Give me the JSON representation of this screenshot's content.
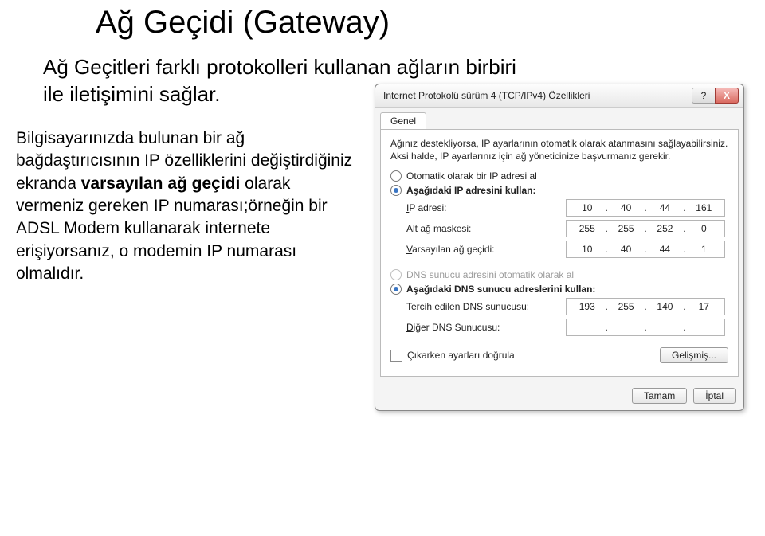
{
  "title": "Ağ Geçidi (Gateway)",
  "subtitle": "Ağ Geçitleri farklı protokolleri kullanan ağların birbiri ile iletişimini sağlar.",
  "paragraph_a": "Bilgisayarınızda bulunan bir ağ bağdaştırıcısının IP özelliklerini değiştirdiğiniz ekranda ",
  "paragraph_bold": "varsayılan ağ geçidi",
  "paragraph_b": " olarak vermeniz gereken IP numarası;örneğin bir ADSL Modem kullanarak internete erişiyorsanız, o modemin IP numarası olmalıdır.",
  "dialog": {
    "title": "Internet Protokolü sürüm 4 (TCP/IPv4) Özellikleri",
    "help_glyph": "?",
    "close_glyph": "X",
    "tab": "Genel",
    "desc": "Ağınız destekliyorsa, IP ayarlarının otomatik olarak atanmasını sağlayabilirsiniz. Aksi halde, IP ayarlarınız için ağ yöneticinize başvurmanız gerekir.",
    "radio1": "Otomatik olarak bir IP adresi al",
    "radio2_prefix_ul": "A",
    "radio2_rest": "şağıdaki IP adresini kullan:",
    "ip_label_prefix": "I",
    "ip_label_rest": "P adresi:",
    "ip_value": [
      "10",
      "40",
      "44",
      "161"
    ],
    "mask_label_prefix": "A",
    "mask_label_rest": "lt ağ maskesi:",
    "mask_value": [
      "255",
      "255",
      "252",
      "0"
    ],
    "gw_label_prefix": "V",
    "gw_label_rest": "arsayılan ağ geçidi:",
    "gw_value": [
      "10",
      "40",
      "44",
      "1"
    ],
    "radio3": "DNS sunucu adresini otomatik olarak al",
    "radio4_prefix_ul": "A",
    "radio4_rest": "şağıdaki DNS sunucu adreslerini kullan:",
    "dns1_label_prefix": "T",
    "dns1_label_rest": "ercih edilen DNS sunucusu:",
    "dns1_value": [
      "193",
      "255",
      "140",
      "17"
    ],
    "dns2_label_prefix": "D",
    "dns2_label_rest": "iğer DNS Sunucusu:",
    "dns2_value": [
      "",
      "",
      "",
      ""
    ],
    "check_exit": "Çıkarken ayarları doğrula",
    "advanced_ul": "G",
    "advanced_rest": "elişmiş...",
    "ok": "Tamam",
    "cancel_ul": "İ",
    "cancel_rest": "ptal"
  }
}
